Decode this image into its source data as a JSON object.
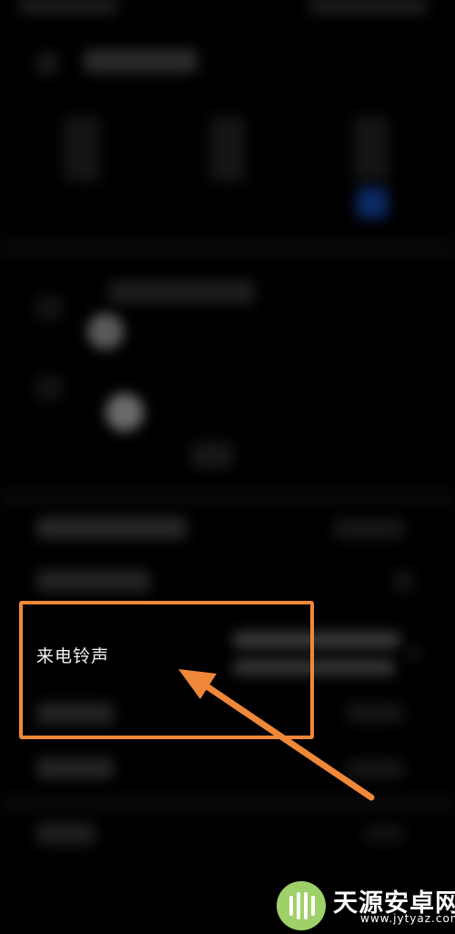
{
  "settings": {
    "ringtone_label": "来电铃声"
  },
  "annotation": {
    "highlight_color": "#f0883a"
  },
  "watermark": {
    "brand": "天源安卓网",
    "url": "www.jytyaz.com",
    "logo_color": "#9fd16a"
  }
}
